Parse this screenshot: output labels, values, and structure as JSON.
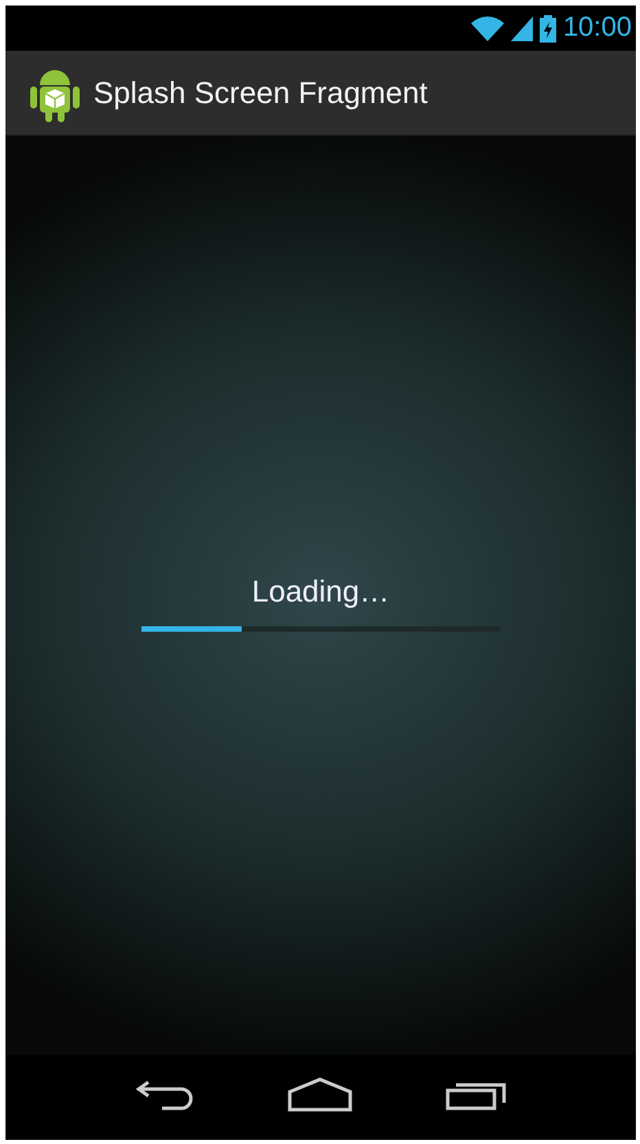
{
  "status_bar": {
    "time": "10:00"
  },
  "action_bar": {
    "title": "Splash Screen Fragment"
  },
  "loading": {
    "label": "Loading…",
    "level": 0.28
  }
}
